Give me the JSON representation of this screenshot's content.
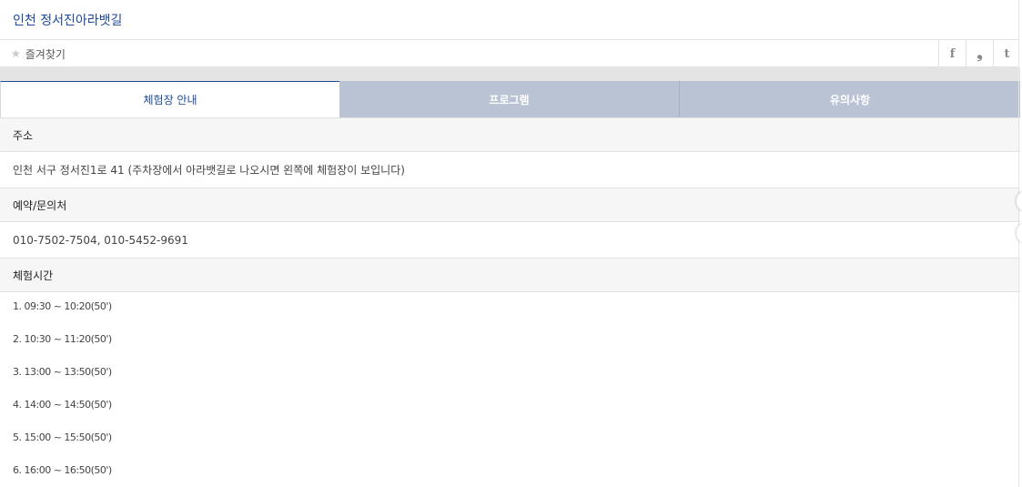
{
  "header": {
    "title": "인천 정서진아라뱃길",
    "favorite_label": "즐겨찾기",
    "share": [
      {
        "name": "facebook-share-button",
        "glyph": "f"
      },
      {
        "name": "kakaostory-share-button",
        "glyph": "❟"
      },
      {
        "name": "tumblr-share-button",
        "glyph": "t"
      }
    ]
  },
  "tabs": [
    "체험장 안내",
    "프로그램",
    "유의사항"
  ],
  "info": {
    "address_label": "주소",
    "address_value": "인천 서구 정서진1로 41 (주차장에서 아라뱃길로 나오시면 왼쪽에 체험장이 보입니다)",
    "reservation_label": "예약/문의처",
    "reservation_value": "010-7502-7504, 010-5452-9691",
    "hours_label": "체험시간",
    "hours": [
      "1. 09:30 ~ 10:20(50')",
      "2. 10:30 ~ 11:20(50')",
      "3. 13:00 ~ 13:50(50')",
      "4. 14:00 ~ 14:50(50')",
      "5. 15:00 ~ 15:50(50')",
      "6. 16:00 ~ 16:50(50')"
    ]
  },
  "colors": {
    "accent": "#1c4a98",
    "tab_inactive": "#b9c3d4",
    "section_bg": "#f6f6f6"
  }
}
